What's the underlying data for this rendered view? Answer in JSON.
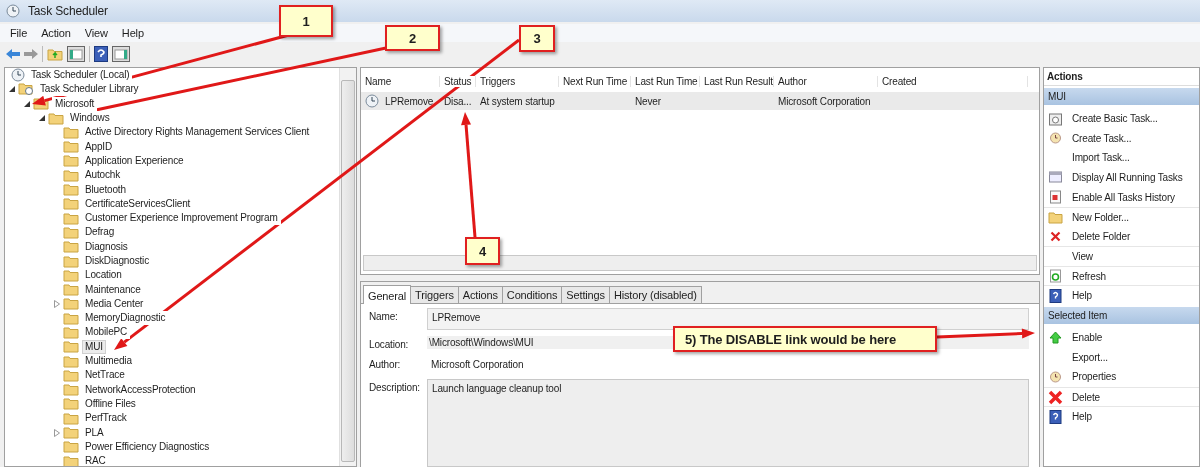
{
  "window": {
    "title": "Task Scheduler"
  },
  "menu": [
    "File",
    "Action",
    "View",
    "Help"
  ],
  "tree": [
    {
      "label": "Task Scheduler (Local)",
      "selected": false,
      "children": [
        {
          "label": "Task Scheduler Library",
          "expanded": true,
          "selected": false,
          "children": [
            {
              "label": "Microsoft",
              "expanded": true,
              "selected": false,
              "children": [
                {
                  "label": "Windows",
                  "expanded": true,
                  "selected": false,
                  "children": [
                    {
                      "label": "Active Directory Rights Management Services Client",
                      "selected": false
                    },
                    {
                      "label": "AppID",
                      "selected": false
                    },
                    {
                      "label": "Application Experience",
                      "selected": false
                    },
                    {
                      "label": "Autochk",
                      "selected": false
                    },
                    {
                      "label": "Bluetooth",
                      "selected": false
                    },
                    {
                      "label": "CertificateServicesClient",
                      "selected": false
                    },
                    {
                      "label": "Customer Experience Improvement Program",
                      "selected": false
                    },
                    {
                      "label": "Defrag",
                      "selected": false
                    },
                    {
                      "label": "Diagnosis",
                      "selected": false
                    },
                    {
                      "label": "DiskDiagnostic",
                      "selected": false
                    },
                    {
                      "label": "Location",
                      "selected": false
                    },
                    {
                      "label": "Maintenance",
                      "selected": false
                    },
                    {
                      "label": "Media Center",
                      "expanded": false,
                      "selected": false
                    },
                    {
                      "label": "MemoryDiagnostic",
                      "selected": false
                    },
                    {
                      "label": "MobilePC",
                      "selected": false
                    },
                    {
                      "label": "MUI",
                      "selected": true
                    },
                    {
                      "label": "Multimedia",
                      "selected": false
                    },
                    {
                      "label": "NetTrace",
                      "selected": false
                    },
                    {
                      "label": "NetworkAccessProtection",
                      "selected": false
                    },
                    {
                      "label": "Offline Files",
                      "selected": false
                    },
                    {
                      "label": "PerfTrack",
                      "selected": false
                    },
                    {
                      "label": "PLA",
                      "expanded": false,
                      "selected": false
                    },
                    {
                      "label": "Power Efficiency Diagnostics",
                      "selected": false
                    },
                    {
                      "label": "RAC",
                      "selected": false
                    }
                  ]
                }
              ]
            }
          ]
        }
      ]
    }
  ],
  "task_list": {
    "columns": [
      "Name",
      "Status",
      "Triggers",
      "Next Run Time",
      "Last Run Time",
      "Last Run Result",
      "Author",
      "Created"
    ],
    "rows": [
      {
        "selected": true,
        "cells": [
          "LPRemove",
          "Disa...",
          "At system startup",
          null,
          "Never",
          null,
          "Microsoft Corporation",
          null
        ]
      }
    ]
  },
  "tabs": [
    {
      "label": "General",
      "selected": true
    },
    {
      "label": "Triggers",
      "selected": false
    },
    {
      "label": "Actions",
      "selected": false
    },
    {
      "label": "Conditions",
      "selected": false
    },
    {
      "label": "Settings",
      "selected": false
    },
    {
      "label": "History (disabled)",
      "selected": false
    }
  ],
  "details": [
    {
      "label": "Name:",
      "value": "LPRemove",
      "kind": "field"
    },
    {
      "label": "Location:",
      "value": "\\Microsoft\\Windows\\MUI",
      "kind": "shaded"
    },
    {
      "label": "Author:",
      "value": "Microsoft Corporation",
      "kind": "plain"
    },
    {
      "label": "Description:",
      "value": "Launch language cleanup tool",
      "kind": "textarea"
    }
  ],
  "actions": {
    "title": "Actions",
    "groups": [
      {
        "title": "MUI",
        "items": [
          {
            "label": "Create Basic Task..."
          },
          {
            "label": "Create Task..."
          },
          {
            "label": "Import Task..."
          },
          {
            "label": "Display All Running Tasks"
          },
          {
            "label": "Enable All Tasks History"
          },
          {
            "label": "New Folder...",
            "group_break": true
          },
          {
            "label": "Delete Folder"
          },
          {
            "label": "View",
            "group_break": true
          },
          {
            "label": "Refresh",
            "group_break": true
          },
          {
            "label": "Help",
            "group_break": true
          }
        ]
      },
      {
        "title": "Selected Item",
        "items": [
          {
            "label": "Enable"
          },
          {
            "label": "Export..."
          },
          {
            "label": "Properties"
          },
          {
            "label": "Delete",
            "group_break": true
          },
          {
            "label": "Help",
            "group_break": true
          }
        ]
      }
    ]
  },
  "callouts": [
    {
      "text": "1"
    },
    {
      "text": "2"
    },
    {
      "text": "3"
    },
    {
      "text": "4"
    },
    {
      "text": "5) The DISABLE link would be here"
    }
  ]
}
